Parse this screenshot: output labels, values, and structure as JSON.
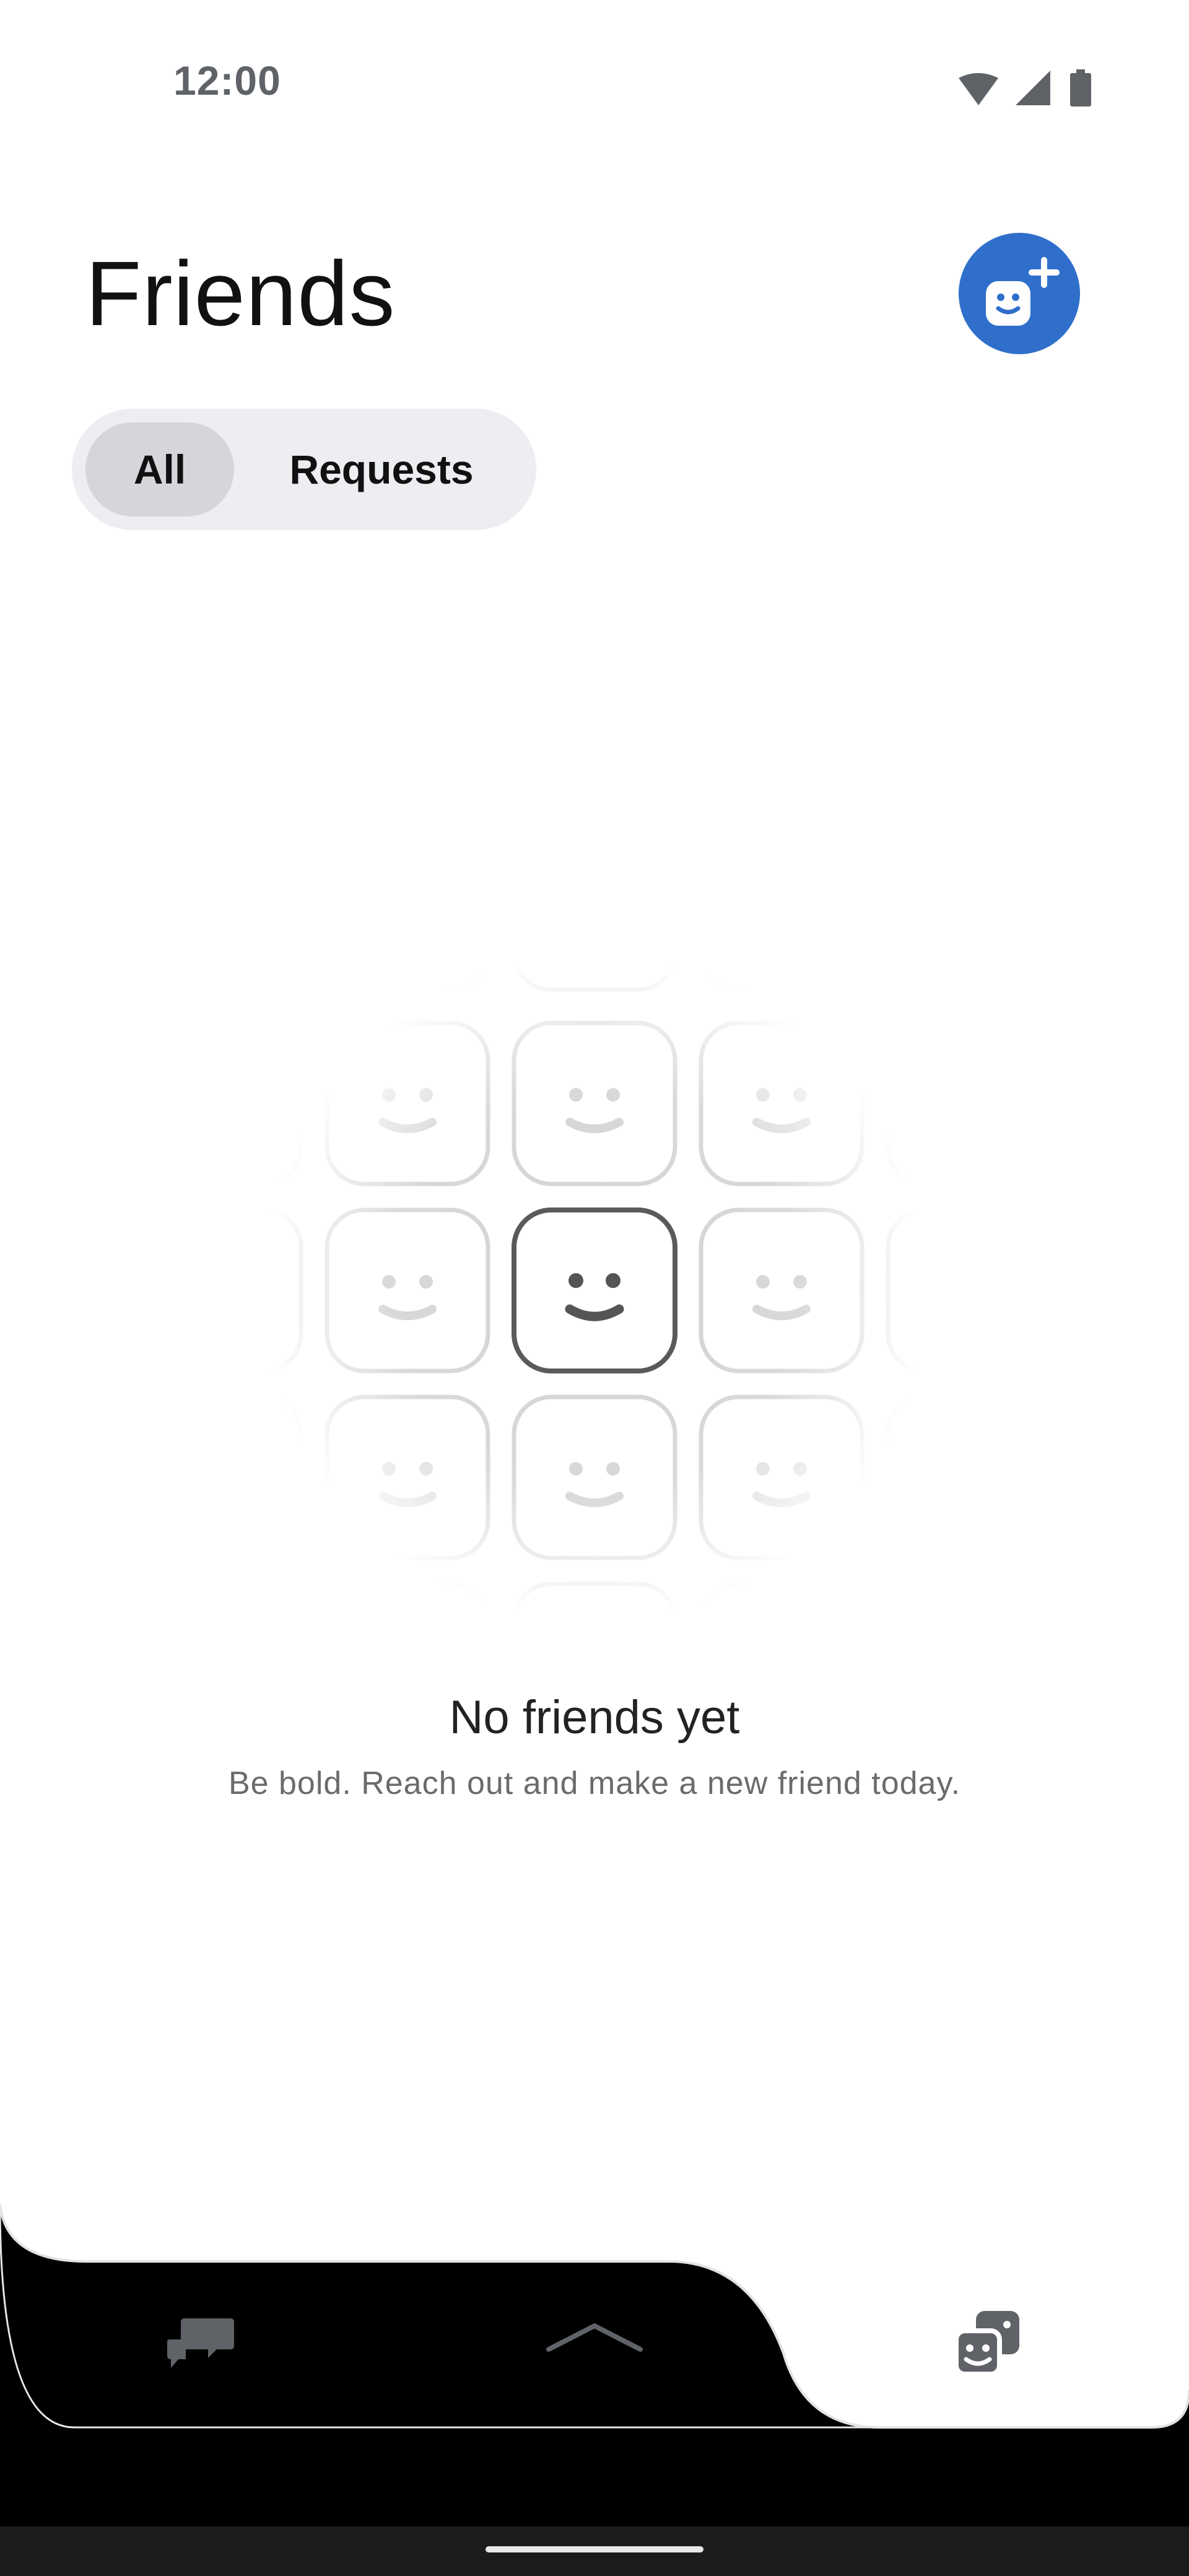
{
  "status_bar": {
    "time": "12:00"
  },
  "header": {
    "title": "Friends"
  },
  "tabs": {
    "all_label": "All",
    "requests_label": "Requests"
  },
  "empty_state": {
    "title": "No friends yet",
    "subtitle": "Be bold. Reach out and make a new friend today."
  },
  "colors": {
    "accent": "#2f6fcb",
    "segment_bg": "#eceef1",
    "segment_selected": "#d4d6da"
  },
  "icons": [
    "wifi-icon",
    "signal-icon",
    "battery-icon",
    "add-friend-icon",
    "chat-icon",
    "chevron-up-icon",
    "games-icon"
  ]
}
